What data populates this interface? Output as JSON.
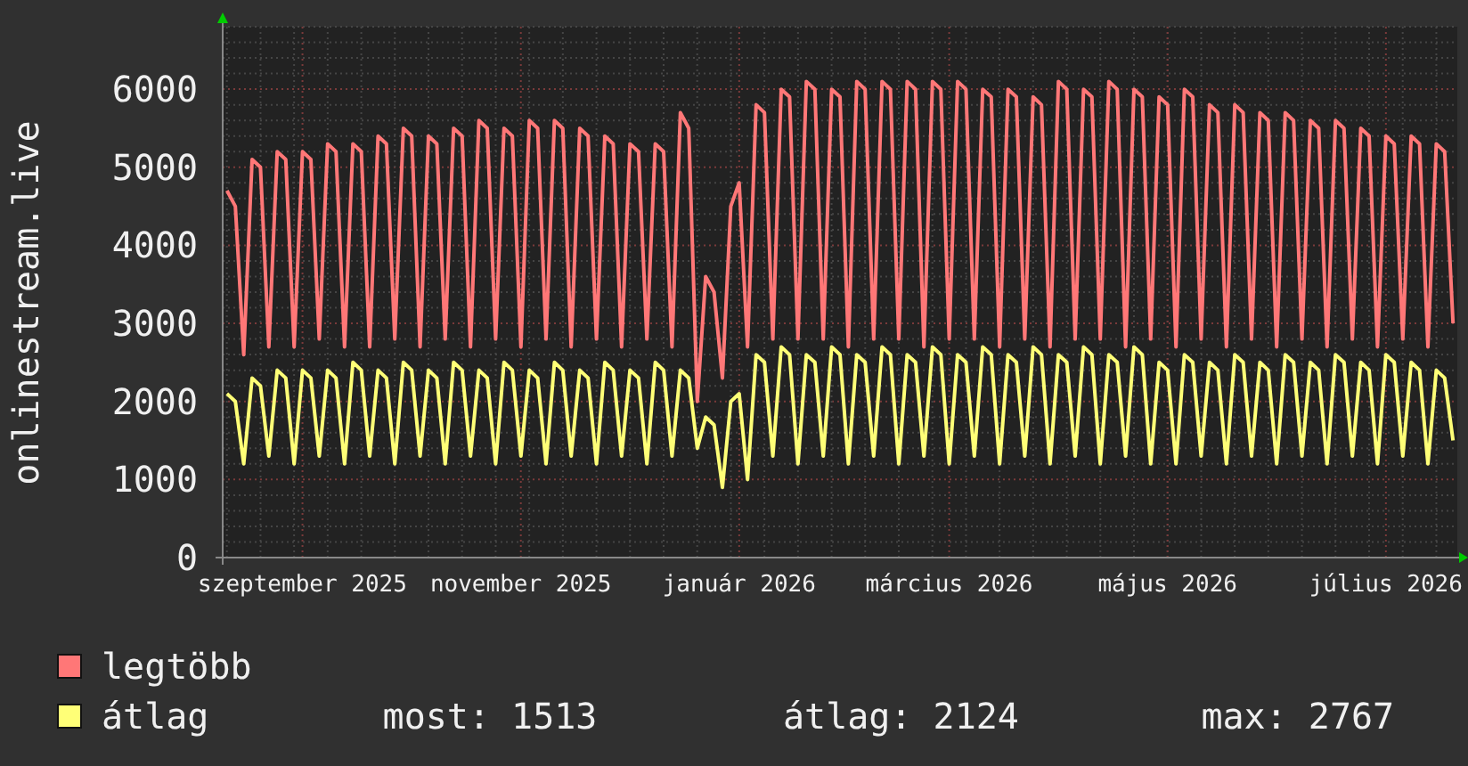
{
  "y_axis_title": "onlinestream.live",
  "chart_data": {
    "type": "line",
    "grid": true,
    "ylim": [
      0,
      6800
    ],
    "yticks": [
      0,
      1000,
      2000,
      3000,
      4000,
      5000,
      6000
    ],
    "categories": [
      null,
      null,
      null,
      null,
      null,
      null,
      null,
      null,
      null,
      "szeptember 2025",
      null,
      null,
      null,
      null,
      null,
      null,
      null,
      null,
      null,
      null,
      null,
      null,
      null,
      null,
      null,
      null,
      null,
      null,
      null,
      null,
      null,
      null,
      null,
      null,
      null,
      "november 2025",
      null,
      null,
      null,
      null,
      null,
      null,
      null,
      null,
      null,
      null,
      null,
      null,
      null,
      null,
      null,
      null,
      null,
      null,
      null,
      null,
      null,
      null,
      null,
      null,
      null,
      "január 2026",
      null,
      null,
      null,
      null,
      null,
      null,
      null,
      null,
      null,
      null,
      null,
      null,
      null,
      null,
      null,
      null,
      null,
      null,
      null,
      null,
      null,
      null,
      null,
      null,
      "március 2026",
      null,
      null,
      null,
      null,
      null,
      null,
      null,
      null,
      null,
      null,
      null,
      null,
      null,
      null,
      null,
      null,
      null,
      null,
      null,
      null,
      null,
      null,
      null,
      null,
      null,
      "május 2026",
      null,
      null,
      null,
      null,
      null,
      null,
      null,
      null,
      null,
      null,
      null,
      null,
      null,
      null,
      null,
      null,
      null,
      null,
      null,
      null,
      null,
      null,
      null,
      null,
      null,
      "július 2026",
      null,
      null,
      null,
      null,
      null,
      null,
      null,
      null
    ],
    "series": [
      {
        "name": "legtöbb",
        "color": "#ff7777",
        "values": [
          4700,
          4500,
          2600,
          5100,
          5000,
          2700,
          5200,
          5100,
          2700,
          5200,
          5100,
          2800,
          5300,
          5200,
          2700,
          5300,
          5200,
          2700,
          5400,
          5300,
          2800,
          5500,
          5400,
          2700,
          5400,
          5300,
          2800,
          5500,
          5400,
          2700,
          5600,
          5500,
          2800,
          5500,
          5400,
          2700,
          5600,
          5500,
          2800,
          5600,
          5500,
          2700,
          5500,
          5400,
          2800,
          5400,
          5300,
          2700,
          5300,
          5200,
          2800,
          5300,
          5200,
          2700,
          5700,
          5500,
          2000,
          3600,
          3400,
          2300,
          4500,
          4800,
          2700,
          5800,
          5700,
          2800,
          6000,
          5900,
          2800,
          6100,
          6000,
          2800,
          6000,
          5900,
          2700,
          6100,
          6000,
          2800,
          6100,
          6000,
          2800,
          6100,
          6000,
          2700,
          6100,
          6000,
          2800,
          6100,
          6000,
          2800,
          6000,
          5900,
          2700,
          6000,
          5900,
          2800,
          5900,
          5800,
          2700,
          6100,
          6000,
          2800,
          6000,
          5900,
          2800,
          6100,
          6000,
          2700,
          6000,
          5900,
          2800,
          5900,
          5800,
          2700,
          6000,
          5900,
          2800,
          5800,
          5700,
          2700,
          5800,
          5700,
          2800,
          5700,
          5600,
          2700,
          5700,
          5600,
          2800,
          5600,
          5500,
          2700,
          5600,
          5500,
          2800,
          5500,
          5400,
          2700,
          5400,
          5300,
          2800,
          5400,
          5300,
          2700,
          5300,
          5200,
          3000
        ]
      },
      {
        "name": "átlag",
        "color": "#ffff77",
        "values": [
          2100,
          2000,
          1200,
          2300,
          2200,
          1300,
          2400,
          2300,
          1200,
          2400,
          2300,
          1300,
          2400,
          2300,
          1200,
          2500,
          2400,
          1300,
          2400,
          2300,
          1200,
          2500,
          2400,
          1300,
          2400,
          2300,
          1200,
          2500,
          2400,
          1300,
          2400,
          2300,
          1200,
          2500,
          2400,
          1300,
          2400,
          2300,
          1200,
          2500,
          2400,
          1300,
          2400,
          2300,
          1200,
          2500,
          2400,
          1300,
          2400,
          2300,
          1200,
          2500,
          2400,
          1300,
          2400,
          2300,
          1400,
          1800,
          1700,
          900,
          2000,
          2100,
          1000,
          2600,
          2500,
          1300,
          2700,
          2600,
          1200,
          2600,
          2500,
          1300,
          2700,
          2600,
          1200,
          2600,
          2500,
          1300,
          2700,
          2600,
          1200,
          2600,
          2500,
          1300,
          2700,
          2600,
          1200,
          2600,
          2500,
          1300,
          2700,
          2600,
          1200,
          2600,
          2500,
          1300,
          2700,
          2600,
          1200,
          2600,
          2500,
          1300,
          2700,
          2600,
          1200,
          2600,
          2500,
          1300,
          2700,
          2600,
          1200,
          2500,
          2400,
          1200,
          2600,
          2500,
          1300,
          2500,
          2400,
          1200,
          2600,
          2500,
          1300,
          2500,
          2400,
          1200,
          2600,
          2500,
          1300,
          2500,
          2400,
          1200,
          2600,
          2500,
          1300,
          2500,
          2400,
          1200,
          2600,
          2500,
          1300,
          2500,
          2400,
          1200,
          2400,
          2300,
          1500
        ]
      }
    ]
  },
  "legend_stats": [
    "most: 1513",
    "átlag: 2124",
    "max: 2767"
  ]
}
